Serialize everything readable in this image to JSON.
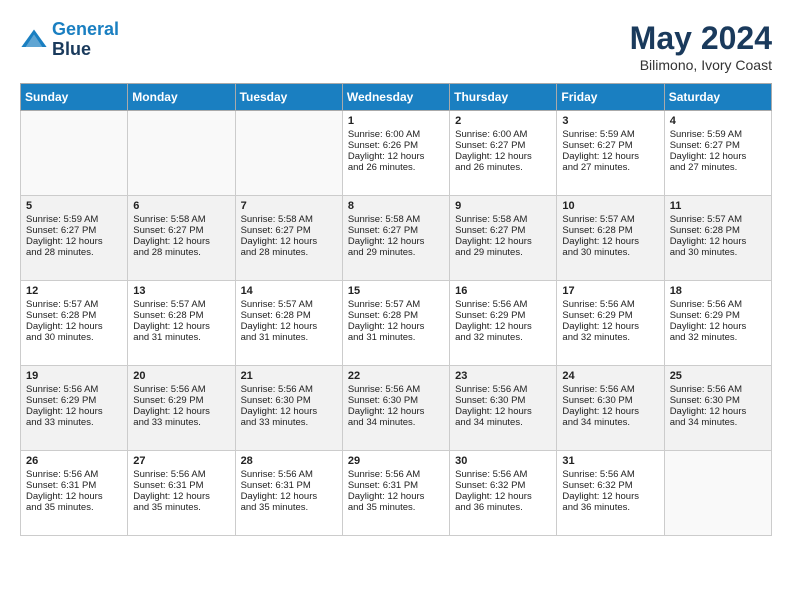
{
  "header": {
    "logo_line1": "General",
    "logo_line2": "Blue",
    "month_year": "May 2024",
    "location": "Bilimono, Ivory Coast"
  },
  "weekdays": [
    "Sunday",
    "Monday",
    "Tuesday",
    "Wednesday",
    "Thursday",
    "Friday",
    "Saturday"
  ],
  "weeks": [
    [
      {
        "day": "",
        "info": ""
      },
      {
        "day": "",
        "info": ""
      },
      {
        "day": "",
        "info": ""
      },
      {
        "day": "1",
        "info": "Sunrise: 6:00 AM\nSunset: 6:26 PM\nDaylight: 12 hours\nand 26 minutes."
      },
      {
        "day": "2",
        "info": "Sunrise: 6:00 AM\nSunset: 6:27 PM\nDaylight: 12 hours\nand 26 minutes."
      },
      {
        "day": "3",
        "info": "Sunrise: 5:59 AM\nSunset: 6:27 PM\nDaylight: 12 hours\nand 27 minutes."
      },
      {
        "day": "4",
        "info": "Sunrise: 5:59 AM\nSunset: 6:27 PM\nDaylight: 12 hours\nand 27 minutes."
      }
    ],
    [
      {
        "day": "5",
        "info": "Sunrise: 5:59 AM\nSunset: 6:27 PM\nDaylight: 12 hours\nand 28 minutes."
      },
      {
        "day": "6",
        "info": "Sunrise: 5:58 AM\nSunset: 6:27 PM\nDaylight: 12 hours\nand 28 minutes."
      },
      {
        "day": "7",
        "info": "Sunrise: 5:58 AM\nSunset: 6:27 PM\nDaylight: 12 hours\nand 28 minutes."
      },
      {
        "day": "8",
        "info": "Sunrise: 5:58 AM\nSunset: 6:27 PM\nDaylight: 12 hours\nand 29 minutes."
      },
      {
        "day": "9",
        "info": "Sunrise: 5:58 AM\nSunset: 6:27 PM\nDaylight: 12 hours\nand 29 minutes."
      },
      {
        "day": "10",
        "info": "Sunrise: 5:57 AM\nSunset: 6:28 PM\nDaylight: 12 hours\nand 30 minutes."
      },
      {
        "day": "11",
        "info": "Sunrise: 5:57 AM\nSunset: 6:28 PM\nDaylight: 12 hours\nand 30 minutes."
      }
    ],
    [
      {
        "day": "12",
        "info": "Sunrise: 5:57 AM\nSunset: 6:28 PM\nDaylight: 12 hours\nand 30 minutes."
      },
      {
        "day": "13",
        "info": "Sunrise: 5:57 AM\nSunset: 6:28 PM\nDaylight: 12 hours\nand 31 minutes."
      },
      {
        "day": "14",
        "info": "Sunrise: 5:57 AM\nSunset: 6:28 PM\nDaylight: 12 hours\nand 31 minutes."
      },
      {
        "day": "15",
        "info": "Sunrise: 5:57 AM\nSunset: 6:28 PM\nDaylight: 12 hours\nand 31 minutes."
      },
      {
        "day": "16",
        "info": "Sunrise: 5:56 AM\nSunset: 6:29 PM\nDaylight: 12 hours\nand 32 minutes."
      },
      {
        "day": "17",
        "info": "Sunrise: 5:56 AM\nSunset: 6:29 PM\nDaylight: 12 hours\nand 32 minutes."
      },
      {
        "day": "18",
        "info": "Sunrise: 5:56 AM\nSunset: 6:29 PM\nDaylight: 12 hours\nand 32 minutes."
      }
    ],
    [
      {
        "day": "19",
        "info": "Sunrise: 5:56 AM\nSunset: 6:29 PM\nDaylight: 12 hours\nand 33 minutes."
      },
      {
        "day": "20",
        "info": "Sunrise: 5:56 AM\nSunset: 6:29 PM\nDaylight: 12 hours\nand 33 minutes."
      },
      {
        "day": "21",
        "info": "Sunrise: 5:56 AM\nSunset: 6:30 PM\nDaylight: 12 hours\nand 33 minutes."
      },
      {
        "day": "22",
        "info": "Sunrise: 5:56 AM\nSunset: 6:30 PM\nDaylight: 12 hours\nand 34 minutes."
      },
      {
        "day": "23",
        "info": "Sunrise: 5:56 AM\nSunset: 6:30 PM\nDaylight: 12 hours\nand 34 minutes."
      },
      {
        "day": "24",
        "info": "Sunrise: 5:56 AM\nSunset: 6:30 PM\nDaylight: 12 hours\nand 34 minutes."
      },
      {
        "day": "25",
        "info": "Sunrise: 5:56 AM\nSunset: 6:30 PM\nDaylight: 12 hours\nand 34 minutes."
      }
    ],
    [
      {
        "day": "26",
        "info": "Sunrise: 5:56 AM\nSunset: 6:31 PM\nDaylight: 12 hours\nand 35 minutes."
      },
      {
        "day": "27",
        "info": "Sunrise: 5:56 AM\nSunset: 6:31 PM\nDaylight: 12 hours\nand 35 minutes."
      },
      {
        "day": "28",
        "info": "Sunrise: 5:56 AM\nSunset: 6:31 PM\nDaylight: 12 hours\nand 35 minutes."
      },
      {
        "day": "29",
        "info": "Sunrise: 5:56 AM\nSunset: 6:31 PM\nDaylight: 12 hours\nand 35 minutes."
      },
      {
        "day": "30",
        "info": "Sunrise: 5:56 AM\nSunset: 6:32 PM\nDaylight: 12 hours\nand 36 minutes."
      },
      {
        "day": "31",
        "info": "Sunrise: 5:56 AM\nSunset: 6:32 PM\nDaylight: 12 hours\nand 36 minutes."
      },
      {
        "day": "",
        "info": ""
      }
    ]
  ]
}
